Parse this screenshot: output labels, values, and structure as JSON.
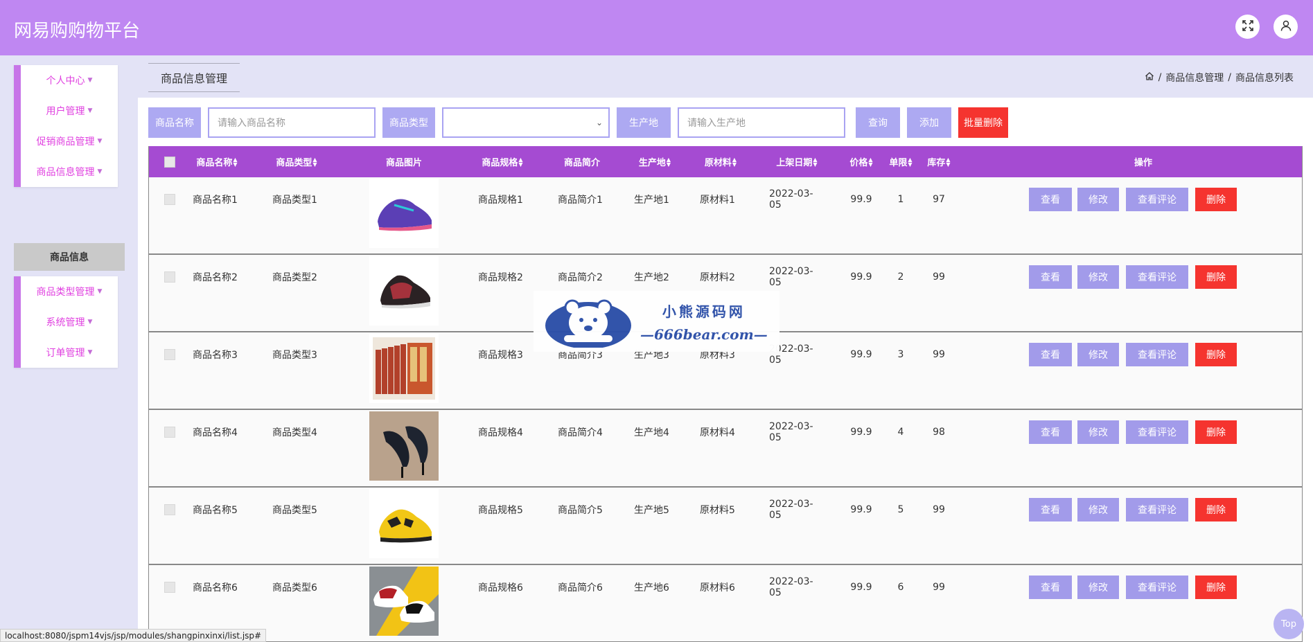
{
  "app": {
    "title": "网易购购物平台"
  },
  "topbar": {
    "fullscreen_icon": "expand-icon",
    "user_icon": "user-icon"
  },
  "sidebar": {
    "group1": [
      {
        "label": "个人中心"
      },
      {
        "label": "用户管理"
      },
      {
        "label": "促销商品管理"
      },
      {
        "label": "商品信息管理"
      }
    ],
    "active_sub": "商品信息",
    "group2": [
      {
        "label": "商品类型管理"
      },
      {
        "label": "系统管理"
      },
      {
        "label": "订单管理"
      }
    ]
  },
  "page_tab": "商品信息管理",
  "breadcrumb": {
    "level1": "商品信息管理",
    "level2": "商品信息列表",
    "sep": "/"
  },
  "search": {
    "name_label": "商品名称",
    "name_placeholder": "请输入商品名称",
    "type_label": "商品类型",
    "origin_label": "生产地",
    "origin_placeholder": "请输入生产地",
    "query_btn": "查询",
    "add_btn": "添加",
    "batch_delete_btn": "批量删除"
  },
  "table": {
    "headers": {
      "name": "商品名称",
      "type": "商品类型",
      "image": "商品图片",
      "spec": "商品规格",
      "intro": "商品简介",
      "origin": "生产地",
      "material": "原材料",
      "date": "上架日期",
      "price": "价格",
      "limit": "单限",
      "stock": "库存",
      "ops": "操作"
    },
    "ops": {
      "view": "查看",
      "edit": "修改",
      "comments": "查看评论",
      "delete": "删除"
    },
    "rows": [
      {
        "name": "商品名称1",
        "type": "商品类型1",
        "spec": "商品规格1",
        "intro": "商品简介1",
        "origin": "生产地1",
        "material": "原材料1",
        "date": "2022-03-05",
        "price": "99.9",
        "limit": "1",
        "stock": "97",
        "image": "basketball-shoe-purple"
      },
      {
        "name": "商品名称2",
        "type": "商品类型2",
        "spec": "商品规格2",
        "intro": "商品简介2",
        "origin": "生产地2",
        "material": "原材料2",
        "date": "2022-03-05",
        "price": "99.9",
        "limit": "2",
        "stock": "99",
        "image": "basketball-shoe-red-black"
      },
      {
        "name": "商品名称3",
        "type": "商品类型3",
        "spec": "商品规格3",
        "intro": "商品简介3",
        "origin": "生产地3",
        "material": "原材料3",
        "date": "2022-03-05",
        "price": "99.9",
        "limit": "3",
        "stock": "99",
        "image": "book-set"
      },
      {
        "name": "商品名称4",
        "type": "商品类型4",
        "spec": "商品规格4",
        "intro": "商品简介4",
        "origin": "生产地4",
        "material": "原材料4",
        "date": "2022-03-05",
        "price": "99.9",
        "limit": "4",
        "stock": "98",
        "image": "black-high-heels"
      },
      {
        "name": "商品名称5",
        "type": "商品类型5",
        "spec": "商品规格5",
        "intro": "商品简介5",
        "origin": "生产地5",
        "material": "原材料5",
        "date": "2022-03-05",
        "price": "99.9",
        "limit": "5",
        "stock": "99",
        "image": "yellow-sneaker"
      },
      {
        "name": "商品名称6",
        "type": "商品类型6",
        "spec": "商品规格6",
        "intro": "商品简介6",
        "origin": "生产地6",
        "material": "原材料6",
        "date": "2022-03-05",
        "price": "99.9",
        "limit": "6",
        "stock": "99",
        "image": "red-white-sneakers"
      }
    ]
  },
  "watermark": {
    "line1": "小熊源码网",
    "line2": "—666bear.com—"
  },
  "top_button": "Top",
  "status_url": "localhost:8080/jspm14vjs/jsp/modules/shangpinxinxi/list.jsp#",
  "colors": {
    "topbar": "#bf87f2",
    "table_header": "#a54bd2",
    "button": "#a29bea",
    "danger": "#f5342f",
    "accent_text": "#e040e0"
  }
}
